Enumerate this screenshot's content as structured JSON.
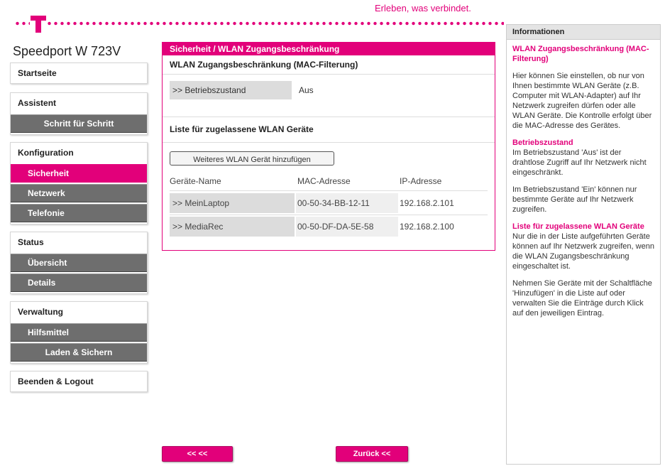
{
  "header": {
    "tagline": "Erleben, was verbindet.",
    "model": "Speedport W 723V"
  },
  "nav": {
    "startseite": "Startseite",
    "assistent": "Assistent",
    "schritt": "Schritt für Schritt",
    "konfiguration": "Konfiguration",
    "sicherheit": "Sicherheit",
    "netzwerk": "Netzwerk",
    "telefonie": "Telefonie",
    "status": "Status",
    "uebersicht": "Übersicht",
    "details": "Details",
    "verwaltung": "Verwaltung",
    "hilfsmittel": "Hilfsmittel",
    "laden": "Laden & Sichern",
    "logout": "Beenden & Logout"
  },
  "main": {
    "title": "Sicherheit / WLAN Zugangsbeschränkung",
    "section1": "WLAN Zugangsbeschränkung (MAC-Filterung)",
    "state_label": ">> Betriebszustand",
    "state_value": "Aus",
    "section2": "Liste für zugelassene WLAN Geräte",
    "add_button": "Weiteres WLAN Gerät hinzufügen",
    "col_name": "Geräte-Name",
    "col_mac": "MAC-Adresse",
    "col_ip": "IP-Adresse",
    "devices": [
      {
        "name": ">> MeinLaptop",
        "mac": "00-50-34-BB-12-11",
        "ip": "192.168.2.101"
      },
      {
        "name": ">> MediaRec",
        "mac": "00-50-DF-DA-5E-58",
        "ip": "192.168.2.100"
      }
    ]
  },
  "buttons": {
    "back": "<< <<",
    "zurueck": "Zurück <<"
  },
  "info": {
    "header": "Informationen",
    "t1": "WLAN Zugangsbeschränkung (MAC-Filterung)",
    "p1": "Hier können Sie einstellen, ob nur von Ihnen bestimmte WLAN Geräte (z.B. Computer mit WLAN-Adapter) auf Ihr Netzwerk zugreifen dürfen oder alle WLAN Geräte. Die Kontrolle erfolgt über die MAC-Adresse des Gerätes.",
    "t2": "Betriebszustand",
    "p2": "Im Betriebszustand 'Aus' ist der drahtlose Zugriff auf Ihr Netzwerk nicht eingeschränkt.",
    "p3": "Im Betriebszustand 'Ein' können nur bestimmte Geräte auf Ihr Netzwerk zugreifen.",
    "t3": "Liste für zugelassene WLAN Geräte",
    "p4": "Nur die in der Liste aufgeführten Geräte können auf Ihr Netzwerk zugreifen, wenn die WLAN Zugangsbeschränkung eingeschaltet ist.",
    "p5": "Nehmen Sie Geräte mit der Schaltfläche 'Hinzufügen' in die Liste auf oder verwalten Sie die Einträge durch Klick auf den jeweiligen Eintrag."
  }
}
